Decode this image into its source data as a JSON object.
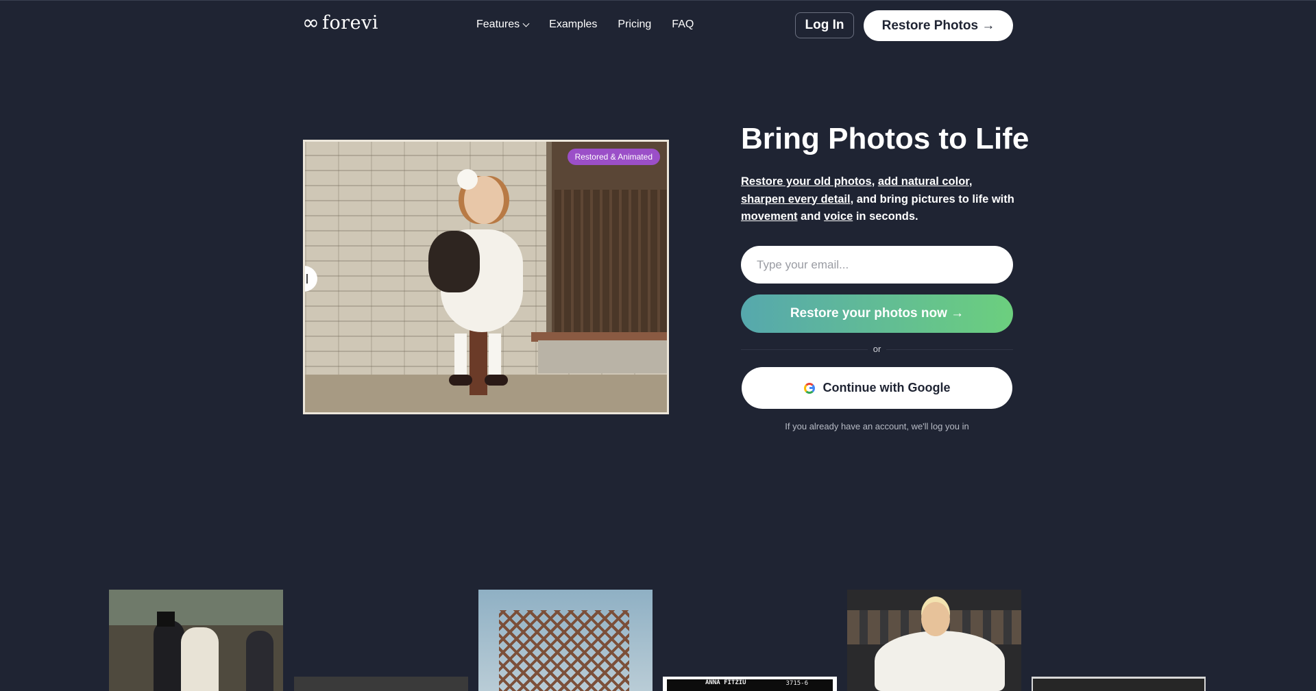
{
  "brand": {
    "logo_mark": "∞",
    "logo_text": "forevi"
  },
  "nav": {
    "features": "Features",
    "examples": "Examples",
    "pricing": "Pricing",
    "faq": "FAQ",
    "login": "Log In",
    "restore_photos": "Restore Photos →"
  },
  "hero": {
    "badge": "Restored & Animated",
    "headline": "Bring Photos to Life",
    "sub": {
      "link1": "Restore your old photos",
      "sep1": ", ",
      "link2": "add natural color",
      "sep2": ", ",
      "link3": "sharpen every detail",
      "mid": ", and bring pictures to life with ",
      "link4": "movement",
      "and": " and ",
      "link5": "voice",
      "end": " in seconds."
    },
    "email_placeholder": "Type your email...",
    "cta": "Restore your photos now →",
    "or": "or",
    "google": "Continue with Google",
    "note": "If you already have an account, we'll log you in"
  },
  "gallery": {
    "caption_name": "ANNA FITZIU",
    "caption_num": "3715-6"
  },
  "colors": {
    "background": "#1f2433",
    "badge": "#9b4fc8",
    "cta_gradient_start": "#56a8ad",
    "cta_gradient_end": "#6ccf7e"
  }
}
